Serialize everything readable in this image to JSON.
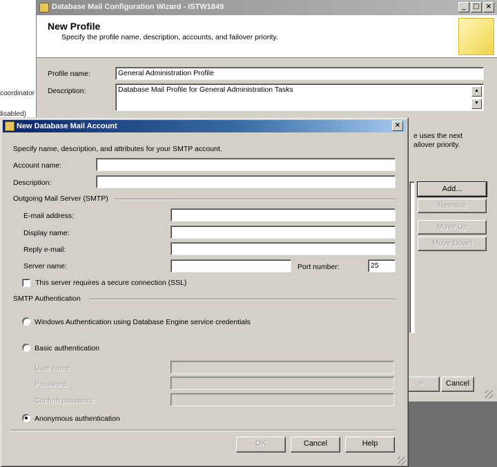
{
  "background": {
    "left_texts": [
      "coordinator",
      "(disabled)"
    ]
  },
  "wizard": {
    "title": "Database Mail Configuration Wizard - ISTW1849",
    "header_title": "New Profile",
    "header_subtitle": "Specify the profile name, description, accounts, and failover priority.",
    "profile_name_label": "Profile name:",
    "profile_name_value": "General Administration Profile",
    "description_label": "Description:",
    "description_value": "Database Mail Profile for General Administration Tasks",
    "priority_text_1": "e uses the next",
    "priority_text_2": "ailover priority.",
    "buttons": {
      "add": "Add...",
      "remove": "Remove",
      "move_up": "Move Up",
      "move_down": "Move Down",
      "next_partial": ">",
      "cancel": "Cancel"
    },
    "controls": {
      "minimize": "_",
      "maximize": "□",
      "close": "×"
    }
  },
  "dialog": {
    "title": "New Database Mail Account",
    "close": "×",
    "intro": "Specify name, description, and attributes for your SMTP account.",
    "account_name_label": "Account name:",
    "account_name_value": "",
    "description_label": "Description:",
    "description_value": "",
    "outgoing_group": "Outgoing Mail Server (SMTP)",
    "email_label": "E-mail address:",
    "email_value": "",
    "display_name_label": "Display name:",
    "display_name_value": "",
    "reply_label": "Reply e-mail:",
    "reply_value": "",
    "server_label": "Server name:",
    "server_value": "",
    "port_label": "Port number:",
    "port_value": "25",
    "ssl_label": "This server requires a secure connection (SSL)",
    "ssl_checked": false,
    "auth_group": "SMTP Authentication",
    "auth_windows": "Windows Authentication using Database Engine service credentials",
    "auth_basic": "Basic authentication",
    "user_label": "User name:",
    "password_label": "Password:",
    "confirm_label": "Confirm password:",
    "auth_anonymous": "Anonymous authentication",
    "selected_auth": "anonymous",
    "ok": "OK",
    "cancel": "Cancel",
    "help": "Help"
  }
}
